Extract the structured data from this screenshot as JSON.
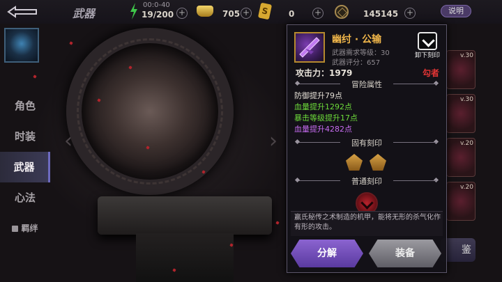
{
  "topbar": {
    "title": "武器",
    "stamina": {
      "timer": "00:0-40",
      "value": "19/200"
    },
    "gold": "705",
    "ticket": {
      "glyph": "S",
      "value": "0"
    },
    "coin": "145145",
    "help_label": "说明"
  },
  "left_menu": [
    {
      "label": "角色",
      "active": false
    },
    {
      "label": "时装",
      "active": false
    },
    {
      "label": "武器",
      "active": true
    },
    {
      "label": "心法",
      "active": false
    },
    {
      "label": "羁绊",
      "locked": true
    }
  ],
  "right_column": {
    "levels": [
      "v.30",
      "v.30",
      "v.20",
      "v.20"
    ],
    "button_fragment": "鉴"
  },
  "detail": {
    "name": "幽纣 · 公输",
    "required_level": "武器需求等级：30",
    "score": "武器评分：657",
    "unload_label": "卸下刻印",
    "attack": "攻击力：1979",
    "class_tag": "勾者",
    "adventure_section": "冒险属性",
    "attributes": [
      {
        "text": "防御提升79点",
        "color": "white"
      },
      {
        "text": "血量提升1292点",
        "color": "green"
      },
      {
        "text": "暴击等级提升17点",
        "color": "green"
      },
      {
        "text": "血量提升4282点",
        "color": "purple"
      }
    ],
    "inherent_section": "固有刻印",
    "normal_section": "普通刻印",
    "description": "赢氏秘传之术制造的机甲，能将无形的杀气化作有形的攻击。",
    "decompose_label": "分解",
    "equip_label": "装备"
  },
  "colors": {
    "accent_purple": "#8b64d0",
    "item_name_gold": "#f0b64a",
    "green_attr": "#6ddc3a",
    "purple_attr": "#c66cf0",
    "class_red": "#e03434"
  }
}
